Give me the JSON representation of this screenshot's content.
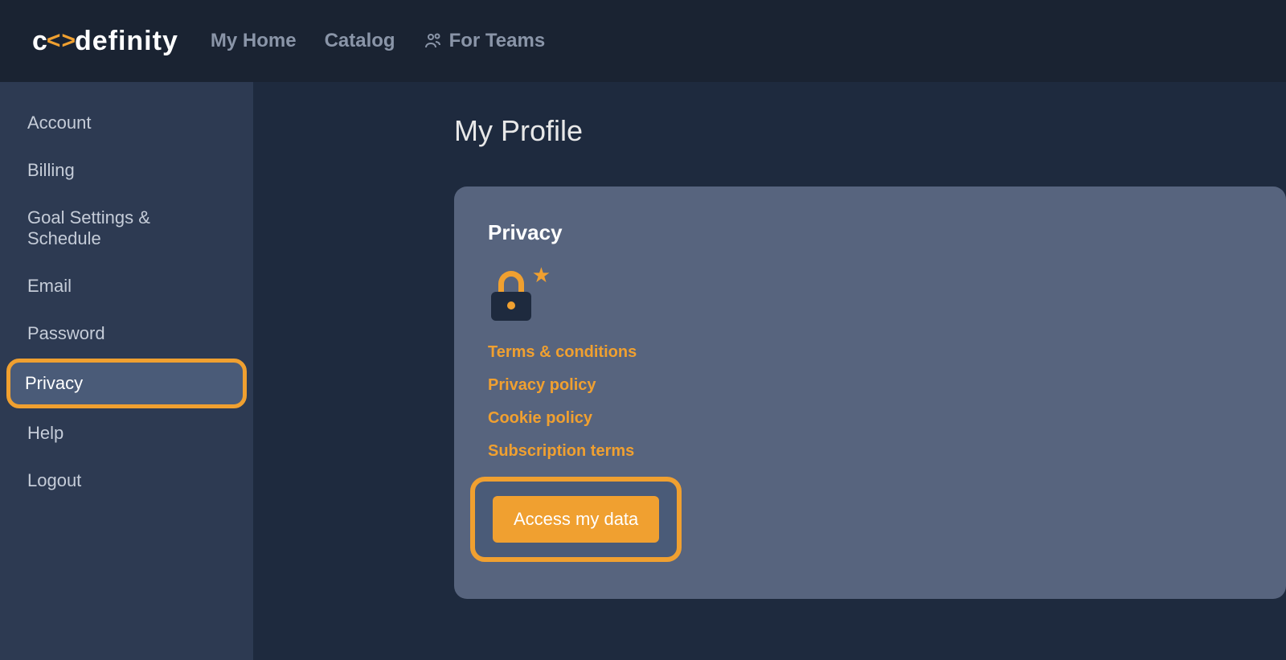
{
  "header": {
    "logo_text_prefix": "c",
    "logo_text_suffix": "definity",
    "nav": {
      "home": "My Home",
      "catalog": "Catalog",
      "teams": "For Teams"
    }
  },
  "sidebar": {
    "items": [
      {
        "label": "Account",
        "active": false
      },
      {
        "label": "Billing",
        "active": false
      },
      {
        "label": "Goal Settings & Schedule",
        "active": false
      },
      {
        "label": "Email",
        "active": false
      },
      {
        "label": "Password",
        "active": false
      },
      {
        "label": "Privacy",
        "active": true
      },
      {
        "label": "Help",
        "active": false
      },
      {
        "label": "Logout",
        "active": false
      }
    ]
  },
  "main": {
    "page_title": "My Profile",
    "card": {
      "title": "Privacy",
      "links": [
        "Terms & conditions",
        "Privacy policy",
        "Cookie policy",
        "Subscription terms"
      ],
      "button_label": "Access my data"
    }
  }
}
